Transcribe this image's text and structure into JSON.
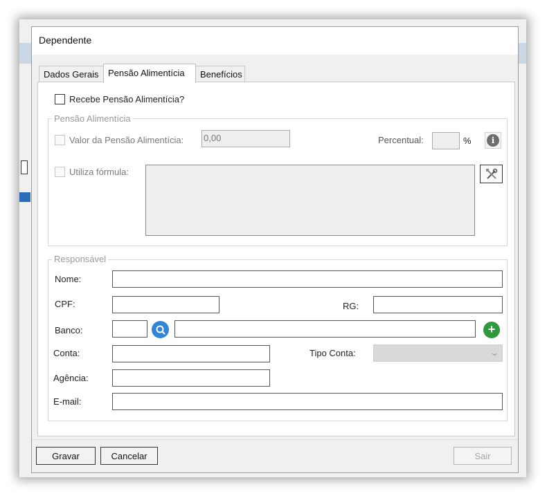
{
  "dialog": {
    "title": "Dependente"
  },
  "tabs": [
    {
      "label": "Dados Gerais"
    },
    {
      "label": "Pensão Alimentícia"
    },
    {
      "label": "Benefícios"
    }
  ],
  "pension": {
    "receives_label": "Recebe Pensão Alimentícia?",
    "group_title": "Pensão Alimentícia",
    "value_label": "Valor da Pensão Alimentícia:",
    "value": "0,00",
    "percent_label": "Percentual:",
    "percent_value": "",
    "percent_unit": "%",
    "formula_label": "Utiliza fórmula:",
    "formula_value": ""
  },
  "responsible": {
    "group_title": "Responsável",
    "name_label": "Nome:",
    "cpf_label": "CPF:",
    "rg_label": "RG:",
    "bank_label": "Banco:",
    "account_label": "Conta:",
    "account_type_label": "Tipo Conta:",
    "agency_label": "Agência:",
    "email_label": "E-mail:"
  },
  "buttons": {
    "save": "Gravar",
    "cancel": "Cancelar",
    "exit": "Sair"
  },
  "icons": {
    "info": "info-icon",
    "formula_edit": "tools-icon",
    "bank_search": "search-icon",
    "bank_add": "plus-icon",
    "dropdown": "chevron-down-icon"
  },
  "colors": {
    "search_blue": "#2f86d6",
    "add_green": "#2e9a3c",
    "info_gray": "#6e6e6e"
  }
}
